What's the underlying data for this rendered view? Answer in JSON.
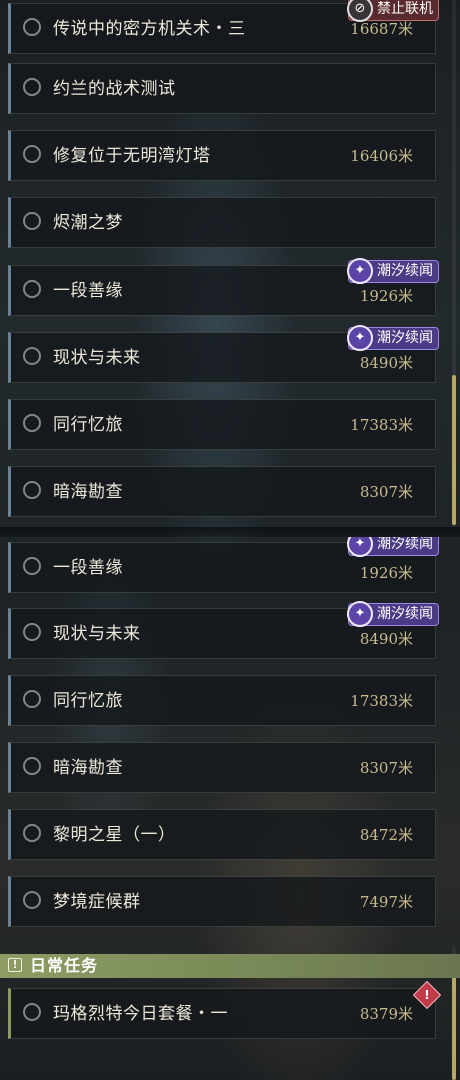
{
  "quests_top": [
    {
      "title": "传说中的密方机关术・三",
      "distance": "16687米",
      "tag": "禁止联机",
      "tag_type": "red"
    },
    {
      "title": "约兰的战术测试",
      "distance": "",
      "tag": ""
    },
    {
      "title": "修复位于无明湾灯塔",
      "distance": "16406米",
      "tag": ""
    },
    {
      "title": "烬潮之梦",
      "distance": "",
      "tag": ""
    },
    {
      "title": "一段善缘",
      "distance": "1926米",
      "tag": "潮汐续闻",
      "tag_type": "purple"
    },
    {
      "title": "现状与未来",
      "distance": "8490米",
      "tag": "潮汐续闻",
      "tag_type": "purple"
    },
    {
      "title": "同行忆旅",
      "distance": "17383米",
      "tag": ""
    },
    {
      "title": "暗海勘查",
      "distance": "8307米",
      "tag": ""
    }
  ],
  "quests_bottom": [
    {
      "title": "一段善缘",
      "distance": "1926米",
      "tag": "潮汐续闻",
      "tag_type": "purple"
    },
    {
      "title": "现状与未来",
      "distance": "8490米",
      "tag": "潮汐续闻",
      "tag_type": "purple"
    },
    {
      "title": "同行忆旅",
      "distance": "17383米",
      "tag": ""
    },
    {
      "title": "暗海勘查",
      "distance": "8307米",
      "tag": ""
    },
    {
      "title": "黎明之星（一）",
      "distance": "8472米",
      "tag": ""
    },
    {
      "title": "梦境症候群",
      "distance": "7497米",
      "tag": ""
    }
  ],
  "daily_section": {
    "title": "日常任务",
    "icon": "exclamation-box-icon",
    "quests": [
      {
        "title": "玛格烈特今日套餐・一",
        "distance": "8379米",
        "alert": true
      }
    ]
  },
  "icons": {
    "tag_purple": "tide-sparkle-icon",
    "tag_red": "no-coop-icon",
    "alert": "diamond-alert-icon"
  },
  "colors": {
    "section_header": "#8c9c63",
    "distance_text": "#c8b98e",
    "tag_purple": "#4b3a86",
    "tag_red": "#5a2b2e",
    "scrollbar": "#b6a769"
  }
}
